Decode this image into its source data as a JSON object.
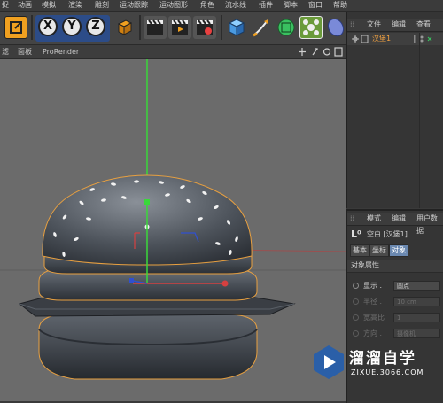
{
  "menu": {
    "items": [
      "捉",
      "动画",
      "模拟",
      "渲染",
      "雕刻",
      "运动跟踪",
      "运动图形",
      "角色",
      "流水线",
      "插件",
      "脚本",
      "窗口",
      "帮助"
    ]
  },
  "toolbar": {
    "axis_x": "X",
    "axis_y": "Y",
    "axis_z": "Z"
  },
  "viewport": {
    "menu_items": [
      "滤",
      "面板",
      "ProRender"
    ]
  },
  "object_manager": {
    "tabs": [
      "文件",
      "编辑",
      "查看"
    ],
    "object_name": "汉堡1"
  },
  "attribute_manager": {
    "tabs": [
      "模式",
      "编辑",
      "用户数据"
    ],
    "object_title": "空白 [汉堡1]",
    "subtabs": [
      "基本",
      "坐标",
      "对象"
    ],
    "section_title": "对象属性",
    "display_label": "显示 .",
    "display_value": "圆点",
    "radius_label": "半径 .",
    "radius_value": "10 cm",
    "aspect_label": "宽高比",
    "aspect_value": "1",
    "orient_label": "方向 .",
    "orient_value": "摄像机"
  },
  "watermark": {
    "title": "溜溜自学",
    "url": "ZIXUE.3066.COM"
  },
  "colors": {
    "viewport_bg": "#6b6b6b",
    "selection_outline": "#e8a040",
    "y_axis": "#33cc33",
    "x_axis": "#d64040",
    "z_axis": "#3050d0",
    "watermark_badge": "#2a5fa8"
  }
}
